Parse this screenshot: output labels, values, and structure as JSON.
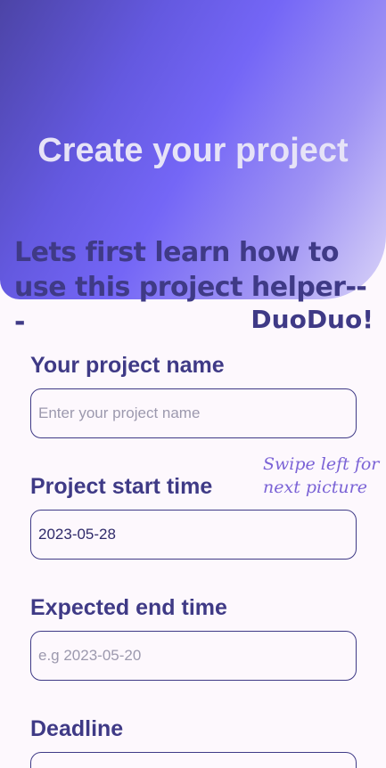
{
  "header": {
    "title": "Create your project"
  },
  "tutorial_banner": {
    "text": "Lets first learn how to use this project helper---",
    "brand": "DuoDuo!"
  },
  "hint": {
    "text": "Swipe left for next picture"
  },
  "form": {
    "project_name": {
      "label": "Your project name",
      "value": "",
      "placeholder": "Enter your project name"
    },
    "start_time": {
      "label": "Project start time",
      "value": "2023-05-28",
      "placeholder": ""
    },
    "end_time": {
      "label": "Expected end time",
      "value": "",
      "placeholder": "e.g 2023-05-20"
    },
    "deadline": {
      "label": "Deadline",
      "value": "",
      "placeholder": ""
    }
  },
  "colors": {
    "primary": "#3f3a86",
    "accent": "#7466f6",
    "hint": "#7b63d6",
    "background": "#fdf8fd"
  }
}
